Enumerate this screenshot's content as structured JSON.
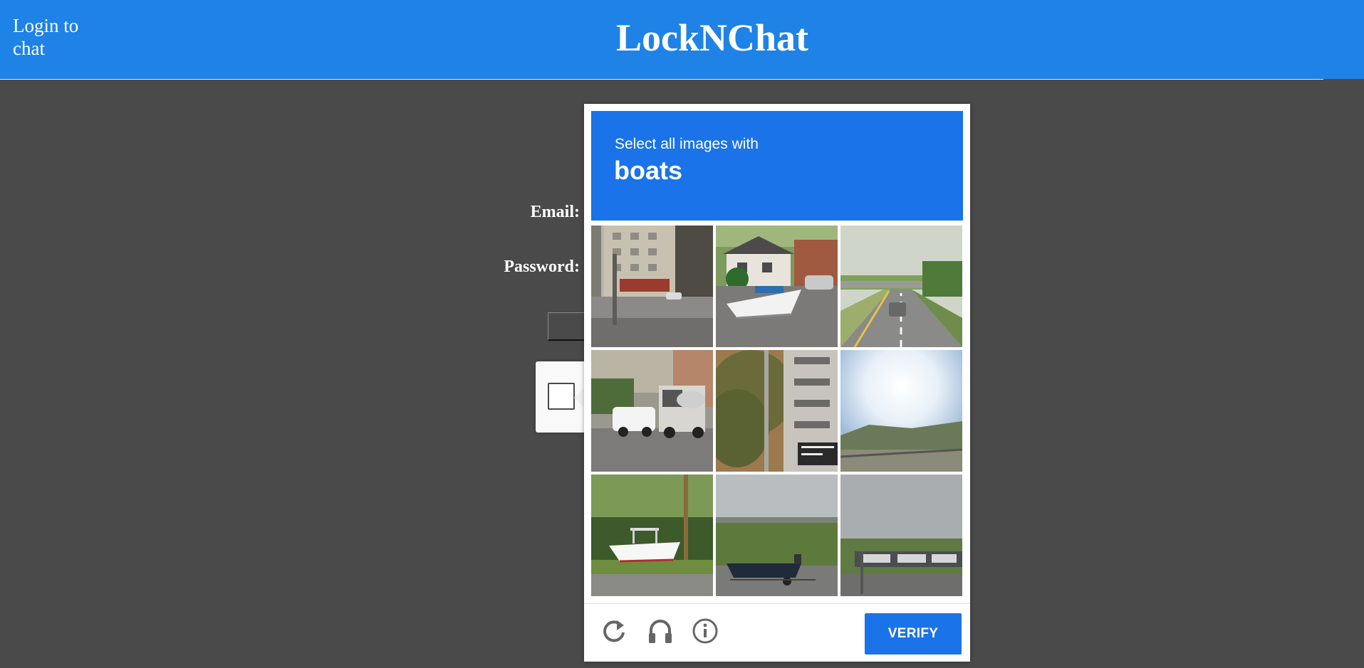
{
  "header": {
    "login_link": "Login to chat",
    "title": "LockNChat",
    "background_color": "#1e82e6"
  },
  "login_form": {
    "email_label": "Email:",
    "password_label": "Password:"
  },
  "recaptcha": {
    "checkbox_checked": false,
    "challenge": {
      "instruction": "Select all images with",
      "keyword": "boats",
      "header_color": "#1a73e8",
      "tiles": [
        {
          "scene": "street corner with tall apartment building"
        },
        {
          "scene": "house driveway with boat on trailer"
        },
        {
          "scene": "highway with overpass and car"
        },
        {
          "scene": "street with white car and truck"
        },
        {
          "scene": "tree beside apartment balconies"
        },
        {
          "scene": "bright sky over landscape"
        },
        {
          "scene": "white boat on trailer by trees"
        },
        {
          "scene": "dark boat on trailer near water"
        },
        {
          "scene": "road with overhead sign gantry"
        }
      ],
      "footer": {
        "reload_icon": "reload-icon",
        "audio_icon": "headphones-icon",
        "info_icon": "info-icon",
        "verify_label": "VERIFY"
      }
    }
  }
}
